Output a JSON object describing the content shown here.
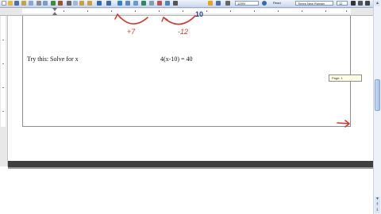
{
  "toolbar": {
    "zoom_value": "125%",
    "read_label": "Read",
    "font_name": "Times New Roman",
    "font_size": "12"
  },
  "document": {
    "prompt_text": "Try this: Solve for x",
    "equation_text": "4(x-10) = 40",
    "annotation_left": "+7",
    "annotation_right": "-12",
    "annotation_topright": "10"
  },
  "tooltip": {
    "text": "Page: 1"
  },
  "colors": {
    "ink_red": "#d8352a",
    "ink_blue": "#1e3fa8"
  }
}
